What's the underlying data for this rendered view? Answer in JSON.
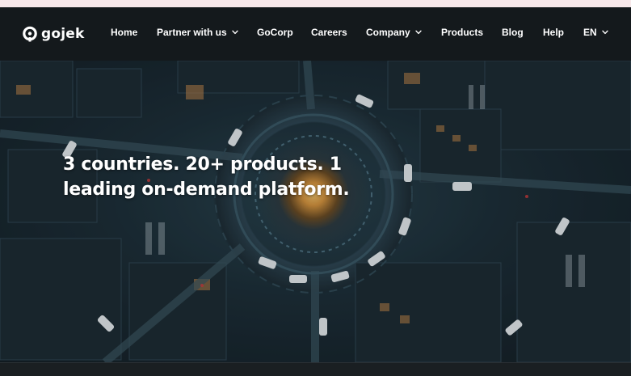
{
  "brand": {
    "name": "gojek",
    "accent": "#00AA13",
    "background": "#14191C",
    "top_strip": "#F7E8EA"
  },
  "nav": {
    "items": [
      {
        "label": "Home",
        "dropdown": false
      },
      {
        "label": "Partner with us",
        "dropdown": true
      },
      {
        "label": "GoCorp",
        "dropdown": false
      },
      {
        "label": "Careers",
        "dropdown": false
      },
      {
        "label": "Company",
        "dropdown": true
      },
      {
        "label": "Products",
        "dropdown": false
      },
      {
        "label": "Blog",
        "dropdown": false
      },
      {
        "label": "Help",
        "dropdown": false
      },
      {
        "label": "EN",
        "dropdown": true
      }
    ]
  },
  "hero": {
    "headline_line1": "3 countries. 20+ products. 1",
    "headline_line2": "leading on-demand platform.",
    "image": "aerial-night-city-roundabout"
  },
  "icons": {
    "logo": "gojek-logo-icon",
    "dropdown": "chevron-down-icon"
  }
}
